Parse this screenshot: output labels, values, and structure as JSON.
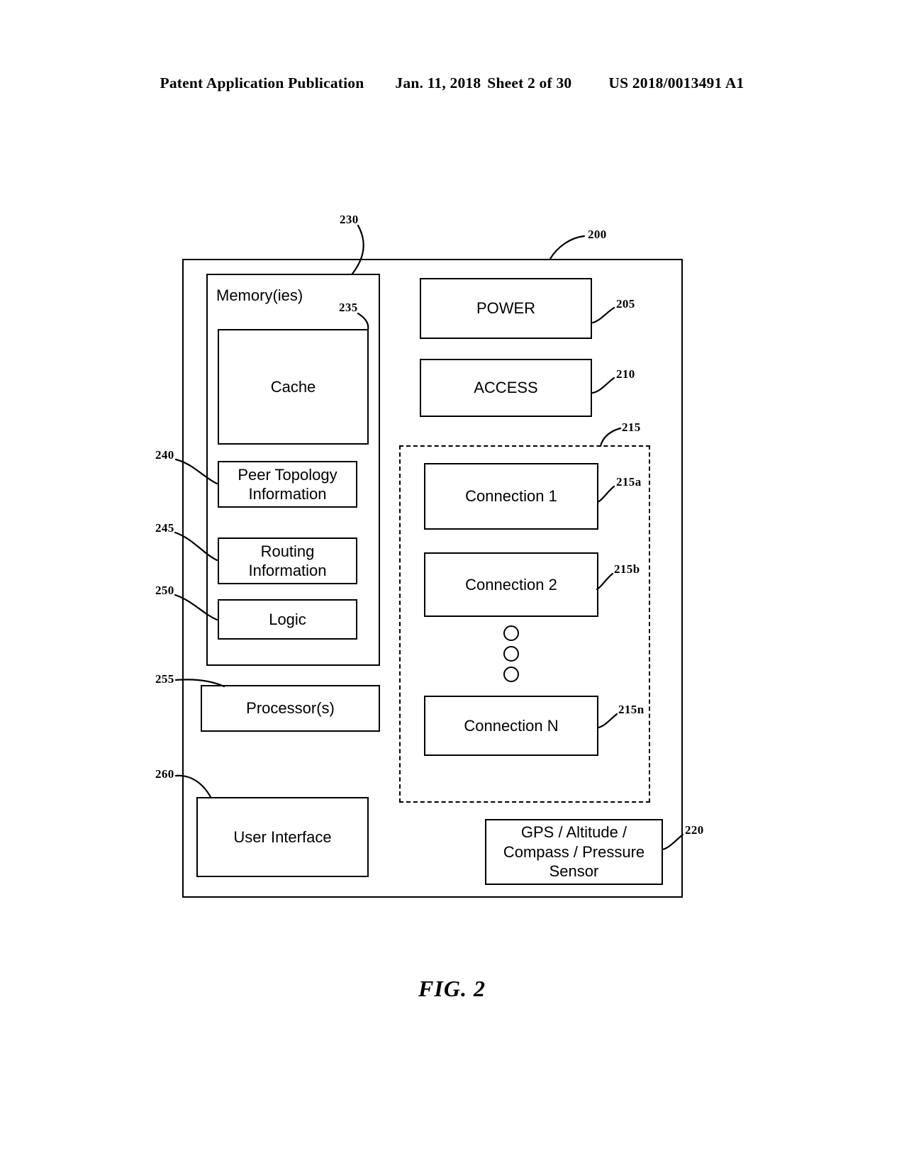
{
  "header": {
    "publication": "Patent Application Publication",
    "date": "Jan. 11, 2018",
    "sheet": "Sheet 2 of 30",
    "patent_number": "US 2018/0013491 A1"
  },
  "figure": {
    "caption": "FIG. 2",
    "device_ref": "200",
    "blocks": {
      "memory": {
        "label": "Memory(ies)",
        "ref": "230"
      },
      "cache": {
        "label": "Cache",
        "ref": "235"
      },
      "peer_topology": {
        "label": "Peer Topology\nInformation",
        "ref": "240"
      },
      "routing": {
        "label": "Routing\nInformation",
        "ref": "245"
      },
      "logic": {
        "label": "Logic",
        "ref": "250"
      },
      "processor": {
        "label": "Processor(s)",
        "ref": "255"
      },
      "user_interface": {
        "label": "User Interface",
        "ref": "260"
      },
      "power": {
        "label": "POWER",
        "ref": "205"
      },
      "access": {
        "label": "ACCESS",
        "ref": "210"
      },
      "connections_group": {
        "ref": "215"
      },
      "connection_1": {
        "label": "Connection 1",
        "ref": "215a"
      },
      "connection_2": {
        "label": "Connection 2",
        "ref": "215b"
      },
      "connection_n": {
        "label": "Connection N",
        "ref": "215n"
      },
      "sensor": {
        "label": "GPS / Altitude /\nCompass / Pressure\nSensor",
        "ref": "220"
      }
    }
  }
}
